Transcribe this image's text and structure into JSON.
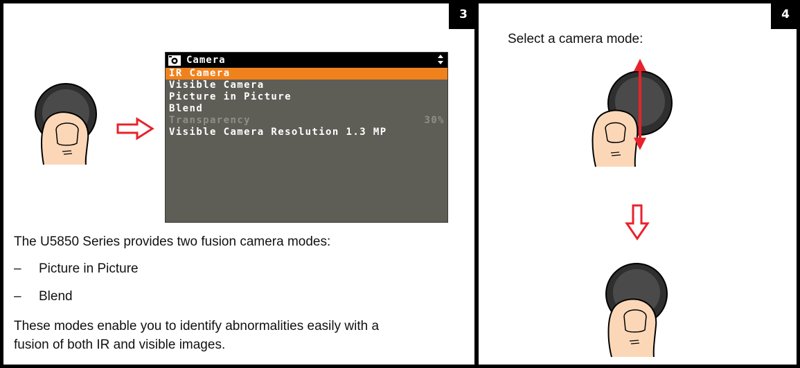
{
  "step3": {
    "badge": "3",
    "screen": {
      "title": "Camera",
      "items": [
        {
          "label": "IR Camera",
          "selected": true
        },
        {
          "label": "Visible Camera"
        },
        {
          "label": "Picture in Picture"
        },
        {
          "label": "Blend"
        },
        {
          "label": "Transparency",
          "value": "30%",
          "disabled": true
        },
        {
          "label": "Visible Camera Resolution 1.3 MP"
        }
      ]
    },
    "intro": "The U5850 Series provides two fusion camera modes:",
    "bullets": [
      "Picture in Picture",
      "Blend"
    ],
    "dash": "–",
    "outro": "These modes enable you to identify abnormalities easily with a fusion of both IR and visible images."
  },
  "step4": {
    "badge": "4",
    "instruction": "Select a camera mode:"
  },
  "colors": {
    "highlight": "#f0821e",
    "arrow_red": "#e8222b",
    "screen_bg": "#5e5d56",
    "skin": "#fbd7b8"
  }
}
